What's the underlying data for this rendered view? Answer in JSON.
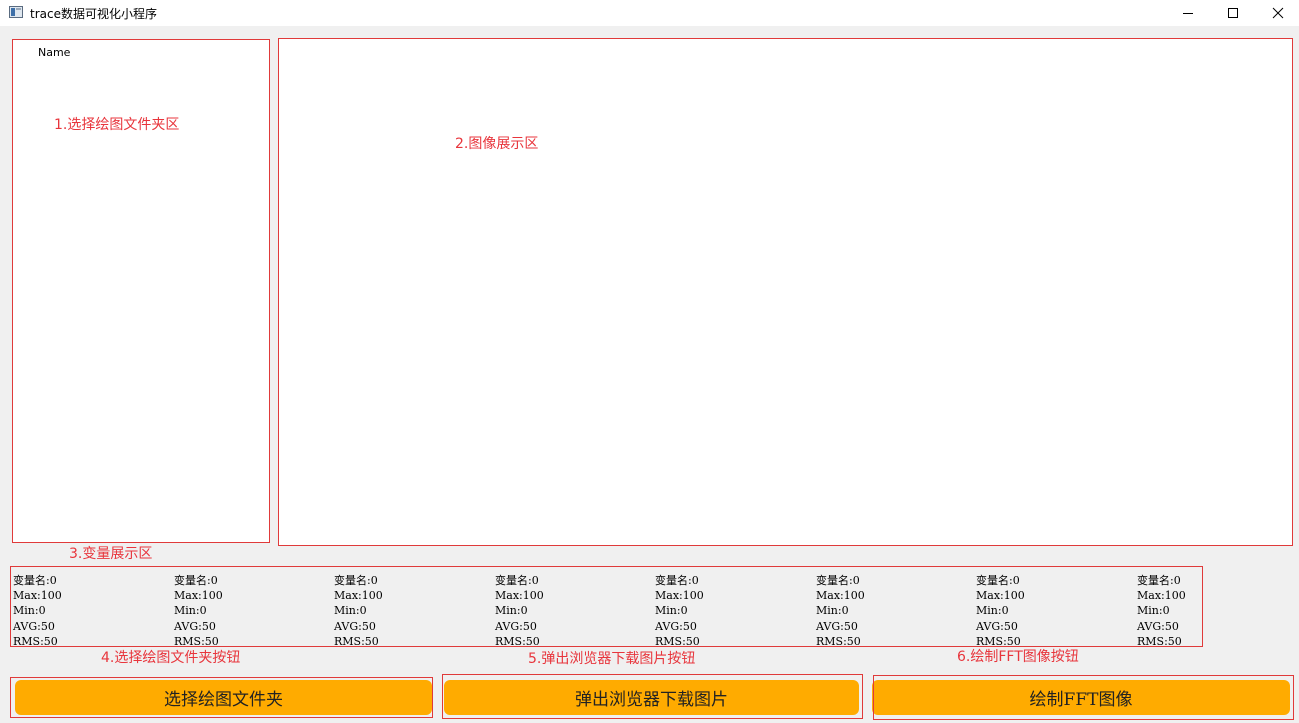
{
  "window": {
    "title": "trace数据可视化小程序",
    "app_icon": "app-window-icon",
    "controls": [
      "minimize-icon",
      "maximize-icon",
      "close-icon"
    ]
  },
  "tree_panel": {
    "header": "Name",
    "annotation": "1.选择绘图文件夹区"
  },
  "image_panel": {
    "annotation": "2.图像展示区"
  },
  "variables_panel": {
    "annotation": "3.变量展示区",
    "columns": [
      {
        "name": "变量名:0",
        "max": "Max:100",
        "min": "Min:0",
        "avg": "AVG:50",
        "rms": "RMS:50"
      },
      {
        "name": "变量名:0",
        "max": "Max:100",
        "min": "Min:0",
        "avg": "AVG:50",
        "rms": "RMS:50"
      },
      {
        "name": "变量名:0",
        "max": "Max:100",
        "min": "Min:0",
        "avg": "AVG:50",
        "rms": "RMS:50"
      },
      {
        "name": "变量名:0",
        "max": "Max:100",
        "min": "Min:0",
        "avg": "AVG:50",
        "rms": "RMS:50"
      },
      {
        "name": "变量名:0",
        "max": "Max:100",
        "min": "Min:0",
        "avg": "AVG:50",
        "rms": "RMS:50"
      },
      {
        "name": "变量名:0",
        "max": "Max:100",
        "min": "Min:0",
        "avg": "AVG:50",
        "rms": "RMS:50"
      },
      {
        "name": "变量名:0",
        "max": "Max:100",
        "min": "Min:0",
        "avg": "AVG:50",
        "rms": "RMS:50"
      },
      {
        "name": "变量名:0",
        "max": "Max:100",
        "min": "Min:0",
        "avg": "AVG:50",
        "rms": "RMS:50"
      }
    ]
  },
  "actions": {
    "select_folder": {
      "label": "选择绘图文件夹",
      "annotation": "4.选择绘图文件夹按钮"
    },
    "download_image": {
      "label": "弹出浏览器下载图片",
      "annotation": "5.弹出浏览器下载图片按钮"
    },
    "draw_fft": {
      "label": "绘制FFT图像",
      "annotation": "6.绘制FFT图像按钮"
    }
  },
  "colors": {
    "annotation_red": "#e8353c",
    "frame_red": "#e03a3a",
    "button_orange": "#ffab00",
    "background": "#f0f0f0"
  }
}
